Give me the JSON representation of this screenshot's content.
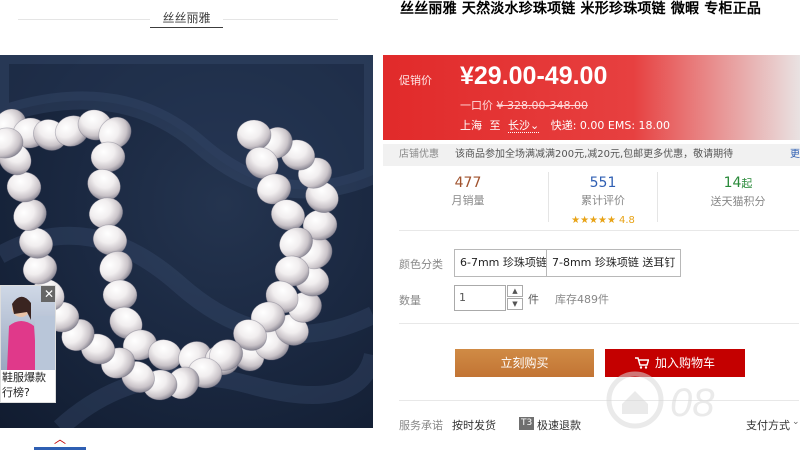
{
  "shop": {
    "name": "丝丝丽雅"
  },
  "ad": {
    "line1": "鞋服爆款",
    "line2": "行榜?",
    "close": "✕"
  },
  "gallery": {
    "up_arrow": "︿"
  },
  "product": {
    "title": "丝丝丽雅 天然淡水珍珠项链 米形珍珠项链 微暇 专柜正品"
  },
  "price": {
    "promo_label": "促销价",
    "promo_price": "¥29.00-49.00",
    "orig_label": "一口价",
    "orig_price": "¥ 328.00-348.00",
    "ship_from": "上海",
    "ship_to_word": "至",
    "ship_to": "长沙",
    "ship_to_arrow": "⌄",
    "ship_fee": "快递: 0.00 EMS: 18.00"
  },
  "promotions": {
    "label": "店铺优惠",
    "text": "该商品参加全场满减满200元,减20元,包邮更多优惠，敬请期待",
    "more": "更"
  },
  "stats": {
    "sold_num": "477",
    "sold_caption": "月销量",
    "review_num": "551",
    "review_caption": "累计评价",
    "review_stars": "★★★★★",
    "review_score": "4.8",
    "points_num": "14",
    "points_unit": "起",
    "points_caption": "送天猫积分"
  },
  "options": {
    "color_label": "颜色分类",
    "skus": [
      "6-7mm 珍珠项链",
      "7-8mm 珍珠项链 送耳钉"
    ],
    "qty_label": "数量",
    "qty_value": "1",
    "qty_up": "▲",
    "qty_down": "▼",
    "qty_unit": "件",
    "stock": "库存489件"
  },
  "actions": {
    "buy_now": "立刻购买",
    "add_to_cart": "加入购物车"
  },
  "service": {
    "label": "服务承诺",
    "item1": "按时发货",
    "badge": "T3",
    "item2": "极速退款",
    "payment": "支付方式",
    "payment_arrow": "⌄"
  },
  "watermark": {
    "text": "08"
  },
  "colors": {
    "price_red": "#e12a2a",
    "cart_red": "#c40000",
    "buy_orange": "#c9803b",
    "link_blue": "#2f5fb3"
  }
}
